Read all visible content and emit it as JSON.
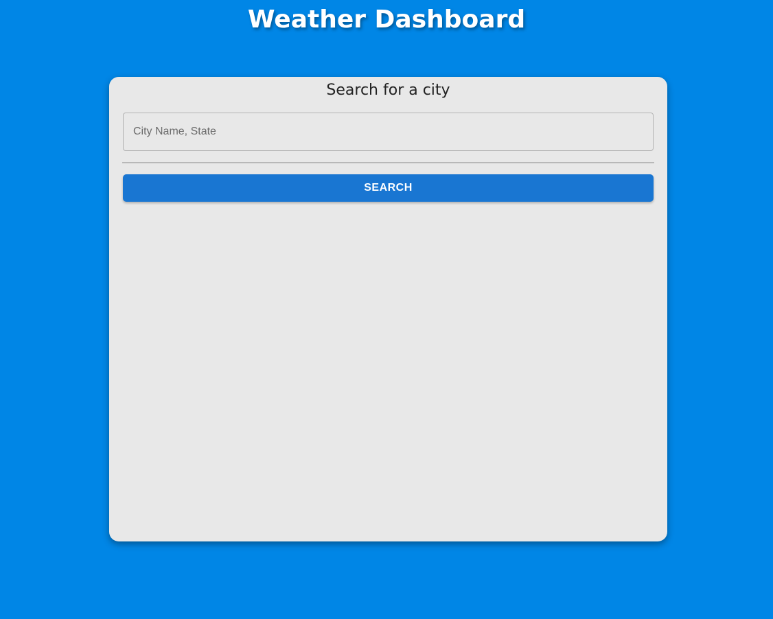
{
  "header": {
    "title": "Weather Dashboard"
  },
  "search_card": {
    "heading": "Search for a city",
    "input": {
      "value": "",
      "placeholder": "City Name, State"
    },
    "button_label": "SEARCH"
  },
  "colors": {
    "page_background": "#0086e6",
    "card_background": "#e8e8e8",
    "button_primary": "#1976d2",
    "title_text": "#ffffff"
  }
}
